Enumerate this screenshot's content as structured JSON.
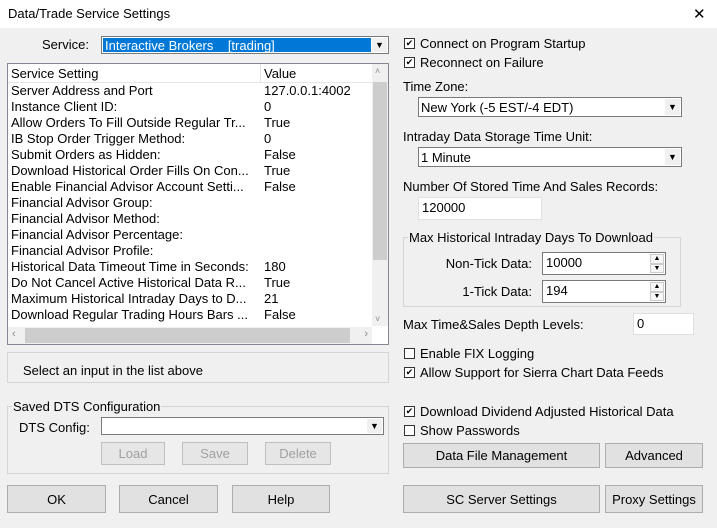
{
  "window": {
    "title": "Data/Trade Service Settings",
    "close": "✕"
  },
  "service": {
    "label": "Service:",
    "value": "Interactive Brokers    [trading]"
  },
  "list": {
    "headers": [
      "Service Setting",
      "Value"
    ],
    "rows": [
      [
        "Server Address and Port",
        "127.0.0.1:4002"
      ],
      [
        "Instance Client ID:",
        "0"
      ],
      [
        "Allow Orders To Fill Outside Regular Tr...",
        "True"
      ],
      [
        "IB Stop Order Trigger Method:",
        "0"
      ],
      [
        "Submit Orders as Hidden:",
        "False"
      ],
      [
        "Download Historical Order Fills On Con...",
        "True"
      ],
      [
        "Enable Financial Advisor Account Setti...",
        "False"
      ],
      [
        "Financial Advisor Group:",
        ""
      ],
      [
        "Financial Advisor Method:",
        ""
      ],
      [
        "Financial Advisor Percentage:",
        ""
      ],
      [
        "Financial Advisor Profile:",
        ""
      ],
      [
        "Historical Data Timeout Time in Seconds:",
        "180"
      ],
      [
        "Do Not Cancel Active Historical Data R...",
        "True"
      ],
      [
        "Maximum Historical Intraday Days to D...",
        "21"
      ],
      [
        "Download Regular Trading Hours Bars ...",
        "False"
      ]
    ]
  },
  "info": "Select an input in the list above",
  "dts": {
    "group": "Saved DTS Configuration",
    "label": "DTS Config:",
    "value": "",
    "load": "Load",
    "save": "Save",
    "delete": "Delete"
  },
  "buttons": {
    "ok": "OK",
    "cancel": "Cancel",
    "help": "Help",
    "sc_server": "SC Server Settings",
    "proxy": "Proxy Settings",
    "data_file": "Data File Management",
    "advanced": "Advanced"
  },
  "right": {
    "connect_startup": {
      "label": "Connect on Program Startup",
      "checked": true
    },
    "reconnect": {
      "label": "Reconnect on Failure",
      "checked": true
    },
    "tz_label": "Time Zone:",
    "tz_value": "New York (-5 EST/-4 EDT)",
    "unit_label": "Intraday Data Storage Time Unit:",
    "unit_value": "1 Minute",
    "records_label": "Number Of Stored Time And Sales Records:",
    "records_value": "120000",
    "max_group": "Max Historical Intraday Days To Download",
    "nontick_label": "Non-Tick Data:",
    "nontick_value": "10000",
    "tick_label": "1-Tick Data:",
    "tick_value": "194",
    "depth_label": "Max Time&Sales Depth Levels:",
    "depth_value": "0",
    "fix": {
      "label": "Enable FIX Logging",
      "checked": false
    },
    "sierra": {
      "label": "Allow Support for Sierra Chart Data Feeds",
      "checked": true
    },
    "dividend": {
      "label": "Download Dividend Adjusted Historical Data",
      "checked": true
    },
    "passwords": {
      "label": "Show Passwords",
      "checked": false
    }
  }
}
